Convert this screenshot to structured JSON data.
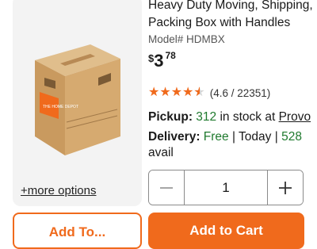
{
  "product": {
    "title": "Heavy Duty Moving, Shipping, Packing Box with Handles",
    "model": "Model# HDMBX",
    "price": {
      "currency": "$",
      "dollars": "3",
      "cents": "78"
    },
    "rating": {
      "stars": 4.6,
      "text": "(4.6 / 22351)"
    },
    "image": {
      "more_options": "+more options",
      "box_logo_text": "THE HOME DEPOT"
    }
  },
  "availability": {
    "pickup_label": "Pickup:",
    "pickup_count": "312",
    "pickup_text": "in stock at",
    "pickup_store": "Provo",
    "delivery_label": "Delivery:",
    "delivery_price": "Free",
    "delivery_sep": "|",
    "delivery_day": "Today",
    "delivery_count": "528",
    "delivery_avail": "avail"
  },
  "quantity": {
    "value": "1",
    "minus_icon": "minus-icon",
    "plus_icon": "plus-icon"
  },
  "actions": {
    "add_to_list": "Add To...",
    "add_to_cart": "Add to Cart"
  },
  "colors": {
    "brand_orange": "#f06a1c",
    "stock_green": "#1f7a2e"
  }
}
